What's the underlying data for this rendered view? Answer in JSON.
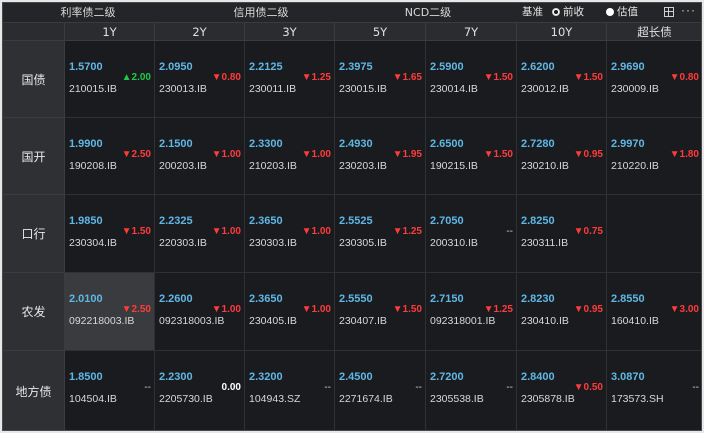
{
  "tabs": [
    "利率债二级",
    "信用债二级",
    "NCD二级"
  ],
  "active_tab": 0,
  "benchmark_label": "基准",
  "radio_options": [
    {
      "label": "前收",
      "selected": true
    },
    {
      "label": "估值",
      "selected": false
    }
  ],
  "more_label": "···",
  "columns": [
    "1Y",
    "2Y",
    "3Y",
    "5Y",
    "7Y",
    "10Y",
    "超长债"
  ],
  "rows": [
    {
      "name": "国债",
      "cells": [
        {
          "yield": "1.5700",
          "change": "▲2.00",
          "dir": "up",
          "code": "210015.IB"
        },
        {
          "yield": "2.0950",
          "change": "▼0.80",
          "dir": "down",
          "code": "230013.IB"
        },
        {
          "yield": "2.2125",
          "change": "▼1.25",
          "dir": "down",
          "code": "230011.IB"
        },
        {
          "yield": "2.3975",
          "change": "▼1.65",
          "dir": "down",
          "code": "230015.IB"
        },
        {
          "yield": "2.5900",
          "change": "▼1.50",
          "dir": "down",
          "code": "230014.IB"
        },
        {
          "yield": "2.6200",
          "change": "▼1.50",
          "dir": "down",
          "code": "230012.IB"
        },
        {
          "yield": "2.9690",
          "change": "▼0.80",
          "dir": "down",
          "code": "230009.IB"
        }
      ]
    },
    {
      "name": "国开",
      "cells": [
        {
          "yield": "1.9900",
          "change": "▼2.50",
          "dir": "down",
          "code": "190208.IB"
        },
        {
          "yield": "2.1500",
          "change": "▼1.00",
          "dir": "down",
          "code": "200203.IB"
        },
        {
          "yield": "2.3300",
          "change": "▼1.00",
          "dir": "down",
          "code": "210203.IB"
        },
        {
          "yield": "2.4930",
          "change": "▼1.95",
          "dir": "down",
          "code": "230203.IB"
        },
        {
          "yield": "2.6500",
          "change": "▼1.50",
          "dir": "down",
          "code": "190215.IB"
        },
        {
          "yield": "2.7280",
          "change": "▼0.95",
          "dir": "down",
          "code": "230210.IB"
        },
        {
          "yield": "2.9970",
          "change": "▼1.80",
          "dir": "down",
          "code": "210220.IB"
        }
      ]
    },
    {
      "name": "口行",
      "cells": [
        {
          "yield": "1.9850",
          "change": "▼1.50",
          "dir": "down",
          "code": "230304.IB"
        },
        {
          "yield": "2.2325",
          "change": "▼1.00",
          "dir": "down",
          "code": "220303.IB"
        },
        {
          "yield": "2.3650",
          "change": "▼1.00",
          "dir": "down",
          "code": "230303.IB"
        },
        {
          "yield": "2.5525",
          "change": "▼1.25",
          "dir": "down",
          "code": "230305.IB"
        },
        {
          "yield": "2.7050",
          "change": "--",
          "dir": "none",
          "code": "200310.IB"
        },
        {
          "yield": "2.8250",
          "change": "▼0.75",
          "dir": "down",
          "code": "230311.IB"
        },
        {
          "yield": "",
          "change": "",
          "dir": "none",
          "code": ""
        }
      ]
    },
    {
      "name": "农发",
      "cells": [
        {
          "yield": "2.0100",
          "change": "▼2.50",
          "dir": "down",
          "code": "092218003.IB"
        },
        {
          "yield": "2.2600",
          "change": "▼1.00",
          "dir": "down",
          "code": "092318003.IB"
        },
        {
          "yield": "2.3650",
          "change": "▼1.00",
          "dir": "down",
          "code": "230405.IB"
        },
        {
          "yield": "2.5550",
          "change": "▼1.50",
          "dir": "down",
          "code": "230407.IB"
        },
        {
          "yield": "2.7150",
          "change": "▼1.25",
          "dir": "down",
          "code": "092318001.IB"
        },
        {
          "yield": "2.8230",
          "change": "▼0.95",
          "dir": "down",
          "code": "230410.IB"
        },
        {
          "yield": "2.8550",
          "change": "▼3.00",
          "dir": "down",
          "code": "160410.IB"
        }
      ]
    },
    {
      "name": "地方债",
      "cells": [
        {
          "yield": "1.8500",
          "change": "--",
          "dir": "none",
          "code": "104504.IB"
        },
        {
          "yield": "2.2300",
          "change": "0.00",
          "dir": "flat",
          "code": "2205730.IB"
        },
        {
          "yield": "2.3200",
          "change": "--",
          "dir": "none",
          "code": "104943.SZ"
        },
        {
          "yield": "2.4500",
          "change": "--",
          "dir": "none",
          "code": "2271674.IB"
        },
        {
          "yield": "2.7200",
          "change": "--",
          "dir": "none",
          "code": "2305538.IB"
        },
        {
          "yield": "2.8400",
          "change": "▼0.50",
          "dir": "down",
          "code": "2305878.IB"
        },
        {
          "yield": "3.0870",
          "change": "--",
          "dir": "none",
          "code": "173573.SH"
        }
      ]
    }
  ],
  "highlighted_cell": {
    "row": 3,
    "col": 0
  }
}
